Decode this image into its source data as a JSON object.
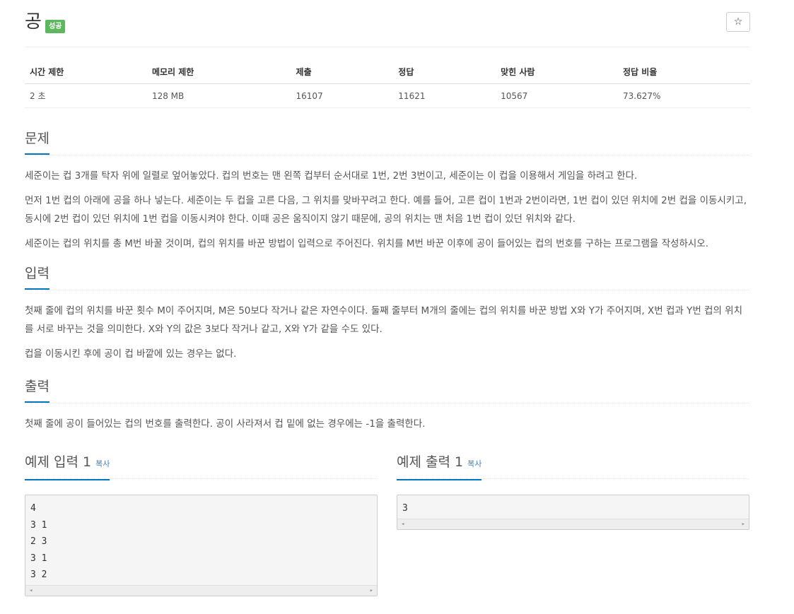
{
  "problem": {
    "title": "공",
    "badge": "성공",
    "star_icon": "star-icon"
  },
  "stats": {
    "headers": [
      "시간 제한",
      "메모리 제한",
      "제출",
      "정답",
      "맞힌 사람",
      "정답 비율"
    ],
    "values": [
      "2 초",
      "128 MB",
      "16107",
      "11621",
      "10567",
      "73.627%"
    ]
  },
  "sections": {
    "problem": {
      "heading": "문제",
      "paragraphs": [
        "세준이는 컵 3개를 탁자 위에 일렬로 엎어놓았다. 컵의 번호는 맨 왼쪽 컵부터 순서대로 1번, 2번 3번이고, 세준이는 이 컵을 이용해서 게임을 하려고 한다.",
        "먼저 1번 컵의 아래에 공을 하나 넣는다. 세준이는 두 컵을 고른 다음, 그 위치를 맞바꾸려고 한다. 예를 들어, 고른 컵이 1번과 2번이라면, 1번 컵이 있던 위치에 2번 컵을 이동시키고, 동시에 2번 컵이 있던 위치에 1번 컵을 이동시켜야 한다. 이때 공은 움직이지 않기 때문에, 공의 위치는 맨 처음 1번 컵이 있던 위치와 같다.",
        "세준이는 컵의 위치를 총 M번 바꿀 것이며, 컵의 위치를 바꾼 방법이 입력으로 주어진다. 위치를 M번 바꾼 이후에 공이 들어있는 컵의 번호를 구하는 프로그램을 작성하시오."
      ]
    },
    "input": {
      "heading": "입력",
      "paragraphs": [
        "첫째 줄에 컵의 위치를 바꾼 횟수 M이 주어지며, M은 50보다 작거나 같은 자연수이다. 둘째 줄부터 M개의 줄에는 컵의 위치를 바꾼 방법 X와 Y가 주어지며, X번 컵과 Y번 컵의 위치를 서로 바꾸는 것을 의미한다. X와 Y의 값은 3보다 작거나 같고, X와 Y가 같을 수도 있다.",
        "컵을 이동시킨 후에 공이 컵 바깥에 있는 경우는 없다."
      ]
    },
    "output": {
      "heading": "출력",
      "paragraphs": [
        "첫째 줄에 공이 들어있는 컵의 번호를 출력한다. 공이 사라져서 컵 밑에 없는 경우에는 -1을 출력한다."
      ]
    }
  },
  "samples": {
    "input": {
      "heading": "예제 입력 1",
      "copy": "복사",
      "lines": [
        "4",
        "3 1",
        "2 3",
        "3 1",
        "3 2"
      ]
    },
    "output": {
      "heading": "예제 출력 1",
      "copy": "복사",
      "lines": [
        "3"
      ]
    },
    "scroll_left": "◂",
    "scroll_right": "▸"
  },
  "colors": {
    "badge": "#5cb85c",
    "heading_underline": "#0076c0",
    "copy_link": "#4a7fb8"
  }
}
